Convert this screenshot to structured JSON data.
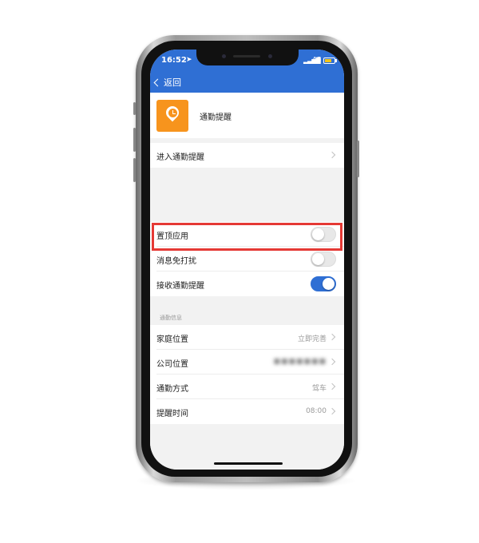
{
  "status_bar": {
    "time": "16:52",
    "network": "4G"
  },
  "nav": {
    "back_label": "返回"
  },
  "header": {
    "title": "通勤提醒"
  },
  "entry": {
    "label": "进入通勤提醒"
  },
  "toggles": [
    {
      "label": "置顶应用",
      "on": false
    },
    {
      "label": "消息免打扰",
      "on": false
    },
    {
      "label": "接收通勤提醒",
      "on": true
    }
  ],
  "info_section": {
    "title": "通勤信息",
    "rows": [
      {
        "label": "家庭位置",
        "value": "立即完善"
      },
      {
        "label": "公司位置",
        "value": "■■■■■■■"
      },
      {
        "label": "通勤方式",
        "value": "驾车"
      },
      {
        "label": "提醒时间",
        "value": "08:00"
      }
    ]
  },
  "colors": {
    "accent": "#2f6fd4",
    "app_icon": "#f7941d",
    "highlight": "#e53935"
  }
}
